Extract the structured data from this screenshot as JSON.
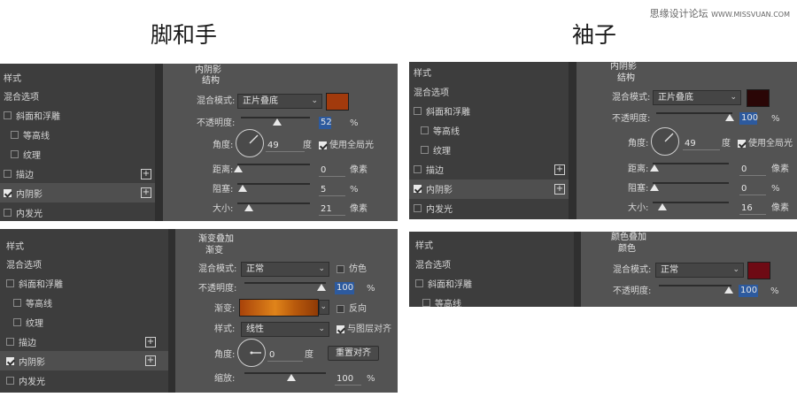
{
  "headings": {
    "left": "脚和手",
    "right": "袖子"
  },
  "watermark": {
    "site": "思缘设计论坛",
    "url": "WWW.MISSVUAN.COM"
  },
  "panel_a": {
    "styles": [
      {
        "label": "样式",
        "type": "header"
      },
      {
        "label": "混合选项",
        "type": "plain"
      },
      {
        "label": "斜面和浮雕",
        "type": "check",
        "checked": false
      },
      {
        "label": "等高线",
        "type": "subcheck",
        "checked": false
      },
      {
        "label": "纹理",
        "type": "subcheck",
        "checked": false
      },
      {
        "label": "描边",
        "type": "check",
        "checked": false,
        "plus": true
      },
      {
        "label": "内阴影",
        "type": "check",
        "checked": true,
        "plus": true,
        "selected": true
      },
      {
        "label": "内发光",
        "type": "check",
        "checked": false
      }
    ],
    "section_title": "内阴影",
    "sub_title": "结构",
    "blend_label": "混合模式:",
    "blend_value": "正片叠底",
    "color": "#a23a0c",
    "opacity_label": "不透明度:",
    "opacity_value": "52",
    "opacity_unit": "%",
    "opacity": 0.52,
    "angle_label": "角度:",
    "angle_value": "49",
    "angle_unit": "度",
    "global_light": "使用全局光",
    "distance_label": "距离:",
    "distance_value": "0",
    "distance_unit": "像素",
    "choke_label": "阻塞:",
    "choke_value": "5",
    "choke_unit": "%",
    "size_label": "大小:",
    "size_value": "21",
    "size_unit": "像素"
  },
  "panel_b": {
    "styles": [
      {
        "label": "样式",
        "type": "header"
      },
      {
        "label": "混合选项",
        "type": "plain"
      },
      {
        "label": "斜面和浮雕",
        "type": "check",
        "checked": false
      },
      {
        "label": "等高线",
        "type": "subcheck",
        "checked": false
      },
      {
        "label": "纹理",
        "type": "subcheck",
        "checked": false
      },
      {
        "label": "描边",
        "type": "check",
        "checked": false,
        "plus": true
      },
      {
        "label": "内阴影",
        "type": "check",
        "checked": true,
        "plus": true,
        "selected": true
      },
      {
        "label": "内发光",
        "type": "check",
        "checked": false
      }
    ],
    "section_title": "内阴影",
    "sub_title": "结构",
    "blend_label": "混合模式:",
    "blend_value": "正片叠底",
    "color": "#2a0606",
    "opacity_label": "不透明度:",
    "opacity_value": "100",
    "opacity_unit": "%",
    "angle_label": "角度:",
    "angle_value": "49",
    "angle_unit": "度",
    "global_light": "使用全局光",
    "distance_label": "距离:",
    "distance_value": "0",
    "distance_unit": "像素",
    "choke_label": "阻塞:",
    "choke_value": "0",
    "choke_unit": "%",
    "size_label": "大小:",
    "size_value": "16",
    "size_unit": "像素"
  },
  "panel_c": {
    "styles": [
      {
        "label": "样式",
        "type": "header"
      },
      {
        "label": "混合选项",
        "type": "plain"
      },
      {
        "label": "斜面和浮雕",
        "type": "check",
        "checked": false
      },
      {
        "label": "等高线",
        "type": "subcheck",
        "checked": false
      },
      {
        "label": "纹理",
        "type": "subcheck",
        "checked": false
      },
      {
        "label": "描边",
        "type": "check",
        "checked": false,
        "plus": true
      },
      {
        "label": "内阴影",
        "type": "check",
        "checked": true,
        "plus": true,
        "selected": true
      },
      {
        "label": "内发光",
        "type": "check",
        "checked": false
      }
    ],
    "section_title": "渐变叠加",
    "sub_title": "渐变",
    "blend_label": "混合模式:",
    "blend_value": "正常",
    "dither": "仿色",
    "opacity_label": "不透明度:",
    "opacity_value": "100",
    "opacity_unit": "%",
    "gradient_label": "渐变:",
    "reverse": "反向",
    "style_label": "样式:",
    "style_value": "线性",
    "align": "与图层对齐",
    "angle_label": "角度:",
    "angle_value": "0",
    "angle_unit": "度",
    "reset": "重置对齐",
    "scale_label": "缩放:",
    "scale_value": "100",
    "scale_unit": "%"
  },
  "panel_d": {
    "styles": [
      {
        "label": "样式",
        "type": "header"
      },
      {
        "label": "混合选项",
        "type": "plain"
      },
      {
        "label": "斜面和浮雕",
        "type": "check",
        "checked": false
      },
      {
        "label": "等高线",
        "type": "subcheck",
        "checked": false
      }
    ],
    "section_title": "颜色叠加",
    "sub_title": "颜色",
    "blend_label": "混合模式:",
    "blend_value": "正常",
    "color": "#6e0a14",
    "opacity_label": "不透明度:",
    "opacity_value": "100",
    "opacity_unit": "%"
  }
}
